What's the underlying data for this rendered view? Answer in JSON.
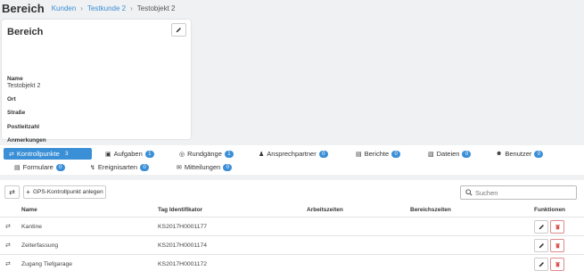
{
  "header": {
    "title": "Bereich",
    "breadcrumb": [
      "Kunden",
      "Testkunde 2",
      "Testobjekt 2"
    ]
  },
  "detail": {
    "title": "Bereich",
    "fields": [
      {
        "label": "Name",
        "value": "Testobjekt 2"
      },
      {
        "label": "Ort",
        "value": ""
      },
      {
        "label": "Straße",
        "value": ""
      },
      {
        "label": "Postleitzahl",
        "value": ""
      },
      {
        "label": "Anmerkungen",
        "value": ""
      }
    ]
  },
  "tabs": [
    {
      "label": "Kontrollpunkte",
      "count": "3",
      "icon": "signal-icon",
      "active": true
    },
    {
      "label": "Aufgaben",
      "count": "1",
      "icon": "briefcase-icon"
    },
    {
      "label": "Rundgänge",
      "count": "1",
      "icon": "target-icon"
    },
    {
      "label": "Ansprechpartner",
      "count": "0",
      "icon": "users-icon"
    },
    {
      "label": "Berichte",
      "count": "0",
      "icon": "document-icon"
    },
    {
      "label": "Dateien",
      "count": "0",
      "icon": "files-icon"
    },
    {
      "label": "Benutzer",
      "count": "0",
      "icon": "user-icon"
    },
    {
      "label": "Formulare",
      "count": "0",
      "icon": "form-icon"
    },
    {
      "label": "Ereignisarten",
      "count": "0",
      "icon": "bolt-icon"
    },
    {
      "label": "Mitteilungen",
      "count": "0",
      "icon": "envelope-icon"
    }
  ],
  "toolbar": {
    "add_label": "GPS-Kontrollpunkt anlegen",
    "search_placeholder": "Suchen"
  },
  "table": {
    "columns": [
      "Name",
      "Tag Identifikator",
      "Arbeitszeiten",
      "Bereichszeiten",
      "Funktionen"
    ],
    "rows": [
      {
        "name": "Kantine",
        "tag": "KS2017H0001177"
      },
      {
        "name": "Zeiterfassung",
        "tag": "KS2017H0001174"
      },
      {
        "name": "Zugang Tiefgarage",
        "tag": "KS2017H0001172"
      }
    ]
  },
  "colors": {
    "accent": "#3a8fd6",
    "danger": "#d9534f"
  }
}
